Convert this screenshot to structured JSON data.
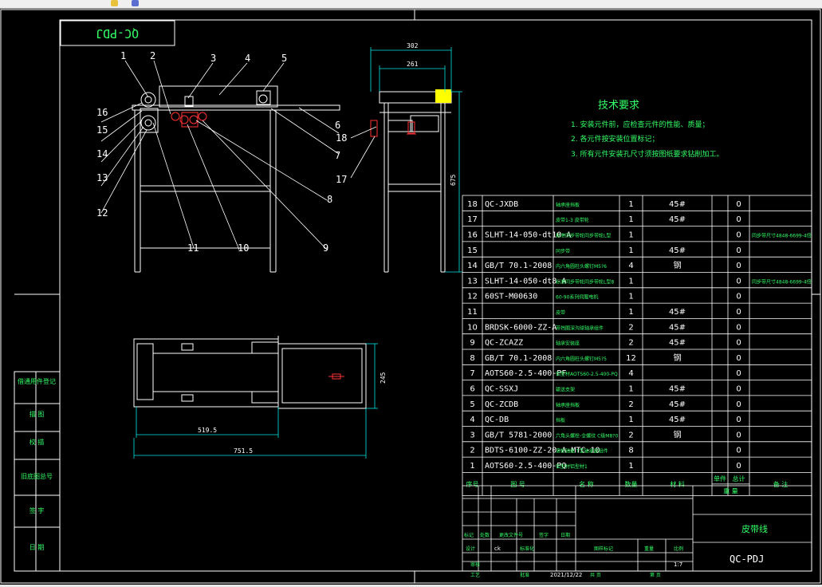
{
  "toolbar": {
    "icons": [
      "toolbar-icon-1",
      "toolbar-icon-2"
    ]
  },
  "drawing": {
    "stamp": "QC-PDJ",
    "callouts": [
      "1",
      "2",
      "3",
      "4",
      "5",
      "16",
      "15",
      "14",
      "13",
      "12",
      "11",
      "10",
      "9",
      "8",
      "7",
      "6",
      "18",
      "17"
    ],
    "dims": {
      "width_top": "302",
      "width_inner": "261",
      "height_side": "675",
      "plan_depth": "245",
      "plan_inner": "519.5",
      "plan_total": "751.5"
    },
    "tech_title": "技术要求",
    "tech_items": [
      "1. 安装元件前，应检查元件的性能、质量；",
      "2. 各元件按安装位置标记；",
      "3. 所有元件安装孔尺寸须按图纸要求钻削加工。"
    ],
    "side_labels": [
      "借通用件登记",
      "描  图",
      "校  描",
      "旧底图总号",
      "签  字",
      "日  期"
    ]
  },
  "bom": {
    "rows": [
      {
        "n": "18",
        "code": "QC-JXDB",
        "name": "轴承座挡板",
        "qty": "1",
        "mat": "45#",
        "w": "0",
        "note": ""
      },
      {
        "n": "17",
        "code": "",
        "name": "皮带1-3 皮带轮",
        "qty": "1",
        "mat": "45#",
        "w": "0",
        "note": ""
      },
      {
        "n": "16",
        "code": "SLHT-14-050-dt10-A",
        "name": "标准同步带轮同步带轮L型",
        "qty": "1",
        "mat": "",
        "w": "0",
        "note": "同步带尺寸4848-6699-4倍"
      },
      {
        "n": "15",
        "code": "",
        "name": "同步带",
        "qty": "1",
        "mat": "45#",
        "w": "0",
        "note": ""
      },
      {
        "n": "14",
        "code": "GB/T 70.1-2008",
        "name": "内六角圆柱头螺钉M5?6",
        "qty": "4",
        "mat": "钢",
        "w": "0",
        "note": ""
      },
      {
        "n": "13",
        "code": "SLHT-14-050-dt8-A",
        "name": "标准同步带轮同步带轮L型8",
        "qty": "1",
        "mat": "",
        "w": "0",
        "note": "同步带尺寸4848-6699-4倍"
      },
      {
        "n": "12",
        "code": "60ST-M00630",
        "name": "60-90系列伺服电机",
        "qty": "1",
        "mat": "",
        "w": "0",
        "note": ""
      },
      {
        "n": "11",
        "code": "",
        "name": "皮带",
        "qty": "1",
        "mat": "45#",
        "w": "0",
        "note": ""
      },
      {
        "n": "10",
        "code": "BRDSK-6000-ZZ-A",
        "name": "带挡圈深沟球轴承组件",
        "qty": "2",
        "mat": "45#",
        "w": "0",
        "note": ""
      },
      {
        "n": "9",
        "code": "QC-ZCAZZ",
        "name": "轴承安装座",
        "qty": "2",
        "mat": "45#",
        "w": "0",
        "note": ""
      },
      {
        "n": "8",
        "code": "GB/T 70.1-2008",
        "name": "内六角圆柱头螺钉M5?5",
        "qty": "12",
        "mat": "钢",
        "w": "0",
        "note": ""
      },
      {
        "n": "7",
        "code": "AOTS60-2.5-400-PF",
        "name": "铝型材AOTS60-2.5-400-PQ",
        "qty": "4",
        "mat": "",
        "w": "0",
        "note": ""
      },
      {
        "n": "6",
        "code": "QC-SSXJ",
        "name": "输送支架",
        "qty": "1",
        "mat": "45#",
        "w": "0",
        "note": ""
      },
      {
        "n": "5",
        "code": "QC-ZCDB",
        "name": "轴承座挡板",
        "qty": "2",
        "mat": "45#",
        "w": "0",
        "note": ""
      },
      {
        "n": "4",
        "code": "QC-DB",
        "name": "挡板",
        "qty": "1",
        "mat": "45#",
        "w": "0",
        "note": ""
      },
      {
        "n": "3",
        "code": "GB/T 5781-2000",
        "name": "六角头螺栓-全螺纹 C级M8?0",
        "qty": "2",
        "mat": "钢",
        "w": "0",
        "note": ""
      },
      {
        "n": "2",
        "code": "BDTS-6100-ZZ-20-A-MTC-10",
        "name": "滚轮轴组 T型轴承座组件",
        "qty": "8",
        "mat": "",
        "w": "0",
        "note": ""
      },
      {
        "n": "1",
        "code": "AOTS60-2.5-400-PQ",
        "name": "铝型材铝型材1",
        "qty": "1",
        "mat": "",
        "w": "0",
        "note": ""
      }
    ],
    "header": [
      "序号",
      "图  号",
      "名  称",
      "数量",
      "材  料",
      "单件",
      "总计",
      "备  注"
    ],
    "header_sub": "重  量"
  },
  "title_block": {
    "product": "皮带线",
    "code": "QC-PDJ",
    "scale": "1:7",
    "date": "2021/12/22",
    "designer": "ck",
    "labels": [
      "标记",
      "处数",
      "更改文件号",
      "签字",
      "日期",
      "设计",
      "标准化",
      "图样标记",
      "重量",
      "比例",
      "审核",
      "工艺",
      "批准",
      "共  页",
      "第  页"
    ]
  },
  "colors": {
    "line": "#ffffff",
    "cyan": "#00e5e5",
    "green": "#33ff66",
    "red": "#ff3333",
    "yellow": "#ffff00",
    "magenta": "#ff55ff"
  }
}
